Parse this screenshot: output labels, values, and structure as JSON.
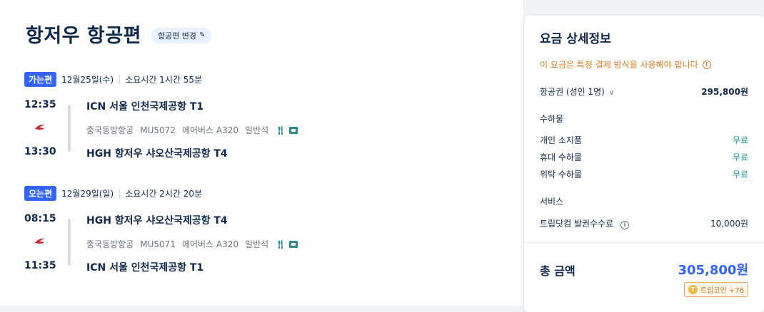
{
  "header": {
    "title": "항저우 항공편",
    "change_label": "항공편 변경"
  },
  "outbound": {
    "tag": "가는편",
    "date": "12월25일(수)",
    "duration": "소요시간 1시간 55분",
    "dep_time": "12:35",
    "dep_airport": "ICN 서울 인천국제공항 T1",
    "airline": "중국동방항공",
    "flight_no": "MU5072",
    "aircraft": "에어버스 A320",
    "cabin": "일반석",
    "arr_time": "13:30",
    "arr_airport": "HGH 항저우 샤오산국제공항 T4"
  },
  "inbound": {
    "tag": "오는편",
    "date": "12월29일(일)",
    "duration": "소요시간 2시간 20분",
    "dep_time": "08:15",
    "dep_airport": "HGH 항저우 샤오산국제공항 T4",
    "airline": "중국동방항공",
    "flight_no": "MU5071",
    "aircraft": "에어버스 A320",
    "cabin": "일반석",
    "arr_time": "11:35",
    "arr_airport": "ICN 서울 인천국제공항 T1"
  },
  "fare": {
    "title": "요금 상세정보",
    "notice": "이 요금은 특정 결제 방식을 사용해야 합니다",
    "ticket_label": "항공권 (성인 1명)",
    "ticket_price": "295,800원",
    "baggage_label": "수하물",
    "baggage": [
      {
        "label": "개인 소지품",
        "value": "무료"
      },
      {
        "label": "휴대 수하물",
        "value": "무료"
      },
      {
        "label": "위탁 수하물",
        "value": "무료"
      }
    ],
    "service_label": "서비스",
    "service_fee_label": "트립닷컴 발권수수료",
    "service_fee_value": "10,000원",
    "total_label": "총 금액",
    "total_value": "305,800원",
    "coin_label": "트립코인 +76"
  },
  "colors": {
    "accent": "#3264ff",
    "navy": "#0f294d",
    "warning": "#e07a1f",
    "free": "#1a9a9e"
  }
}
